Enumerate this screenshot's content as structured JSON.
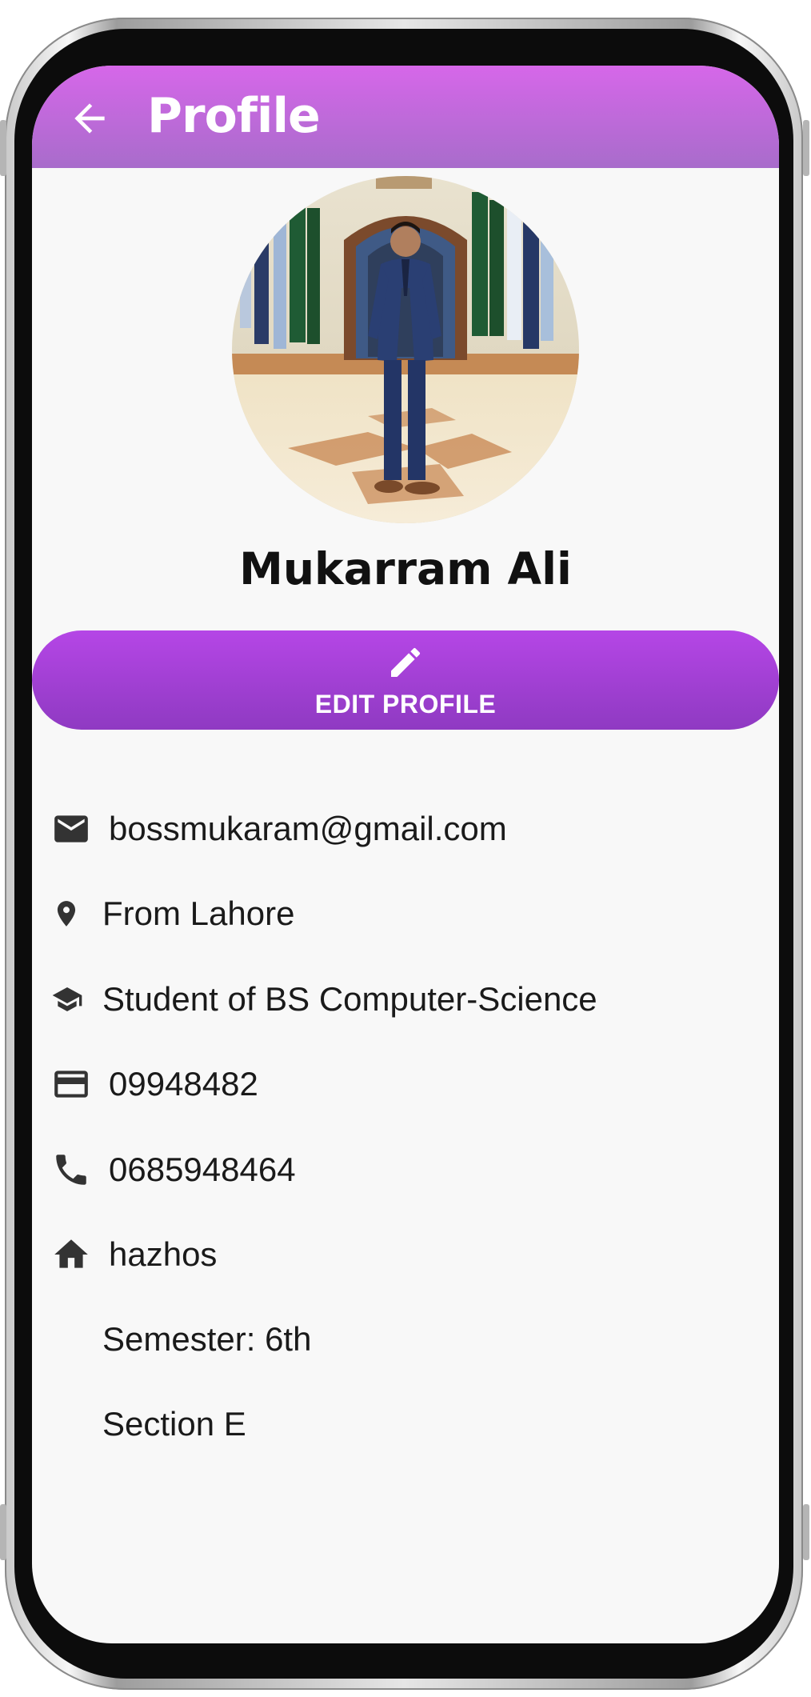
{
  "app_bar": {
    "title": "Profile",
    "back_icon": "arrow-left-icon",
    "gradient": [
      "#d667e9",
      "#a86ccb"
    ]
  },
  "profile": {
    "name": "Mukarram Ali",
    "avatar_description_icon": "profile-photo"
  },
  "edit_button": {
    "label": "EDIT PROFILE",
    "icon": "pencil-icon",
    "gradient": [
      "#b546e6",
      "#8f3ac2"
    ]
  },
  "details": {
    "email": "bossmukaram@gmail.com",
    "location": "From Lahore",
    "education": "Student of BS Computer-Science",
    "id_number": "09948482",
    "phone": "0685948464",
    "residence": "hazhos",
    "semester": "Semester: 6th",
    "section": "Section E"
  },
  "icons": {
    "email": "email-icon",
    "location": "location-pin-icon",
    "education": "graduation-cap-icon",
    "id_number": "credit-card-icon",
    "phone": "phone-icon",
    "residence": "home-icon"
  }
}
